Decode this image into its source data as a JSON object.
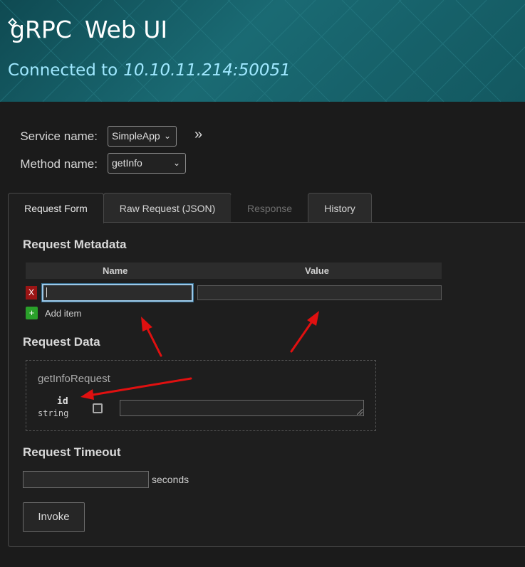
{
  "header": {
    "logo_text": "gRPC",
    "title": "Web UI",
    "connected_label": "Connected to",
    "address": "10.10.11.214:50051"
  },
  "selection": {
    "service_label": "Service name:",
    "service_value": "SimpleApp",
    "method_label": "Method name:",
    "method_value": "getInfo",
    "expand_glyph": "»"
  },
  "tabs": [
    {
      "label": "Request Form",
      "state": "active"
    },
    {
      "label": "Raw Request (JSON)",
      "state": "normal"
    },
    {
      "label": "Response",
      "state": "disabled"
    },
    {
      "label": "History",
      "state": "normal"
    }
  ],
  "metadata": {
    "heading": "Request Metadata",
    "col_name": "Name",
    "col_value": "Value",
    "delete_label": "X",
    "add_icon": "+",
    "add_label": "Add item",
    "row": {
      "name": "",
      "value": ""
    }
  },
  "request_data": {
    "heading": "Request Data",
    "message_name": "getInfoRequest",
    "field": {
      "name": "id",
      "type": "string",
      "value": ""
    }
  },
  "timeout": {
    "heading": "Request Timeout",
    "value": "",
    "unit": "seconds"
  },
  "invoke_label": "Invoke",
  "colors": {
    "header_bg": "#14616a",
    "connected_text": "#9fe8ff",
    "delete_red": "#9b1515",
    "add_green": "#2aa02a",
    "annotation_arrow": "#e01010"
  }
}
